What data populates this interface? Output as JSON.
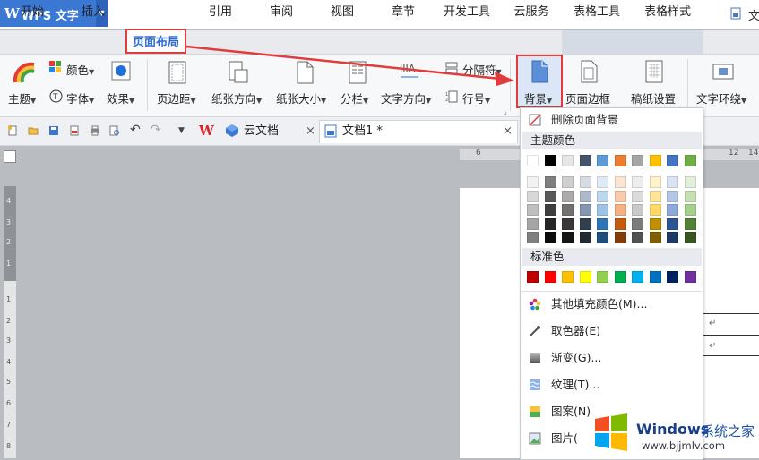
{
  "app": {
    "logo": "W",
    "name": "WPS 文字",
    "right_label": "文"
  },
  "tabs": [
    {
      "label": "开始"
    },
    {
      "label": "插入"
    },
    {
      "label": "页面布局"
    },
    {
      "label": "引用"
    },
    {
      "label": "审阅"
    },
    {
      "label": "视图"
    },
    {
      "label": "章节"
    },
    {
      "label": "开发工具"
    },
    {
      "label": "云服务"
    },
    {
      "label": "表格工具"
    },
    {
      "label": "表格样式"
    }
  ],
  "ribbon": {
    "theme": "主题",
    "color": "颜色",
    "font": "字体",
    "effect": "效果",
    "margins": "页边距",
    "orientation": "纸张方向",
    "size": "纸张大小",
    "columns": "分栏",
    "text_direction": "文字方向",
    "breaks": "分隔符",
    "line_numbers": "行号",
    "background": "背景",
    "page_border": "页面边框",
    "manuscript": "稿纸设置",
    "wrap": "文字环绕"
  },
  "doctabs": {
    "cloud": "云文档",
    "doc1": "文档1 *"
  },
  "menu": {
    "remove_bg": "删除页面背景",
    "theme_colors_header": "主题颜色",
    "standard_colors_header": "标准色",
    "more_fill": "其他填充颜色(M)...",
    "picker": "取色器(E)",
    "gradient": "渐变(G)...",
    "texture": "纹理(T)...",
    "pattern": "图案(N)",
    "picture": "图片("
  },
  "theme_top": [
    "#ffffff",
    "#000000",
    "#e7e6e6",
    "#44546a",
    "#5b9bd5",
    "#ed7d31",
    "#a5a5a5",
    "#ffc000",
    "#4472c4",
    "#70ad47"
  ],
  "theme_shades": [
    [
      "#f2f2f2",
      "#7f7f7f",
      "#d0cece",
      "#d6dce4",
      "#deebf6",
      "#fbe5d5",
      "#ededed",
      "#fff2cc",
      "#dae3f3",
      "#e2efd9"
    ],
    [
      "#d8d8d8",
      "#595959",
      "#aeabab",
      "#adb9ca",
      "#bdd7ee",
      "#f7cbac",
      "#dbdbdb",
      "#fee599",
      "#b4c6e7",
      "#c5e0b3"
    ],
    [
      "#bfbfbf",
      "#3f3f3f",
      "#757070",
      "#8496b0",
      "#9cc3e5",
      "#f4b183",
      "#c9c9c9",
      "#ffd965",
      "#8eaadb",
      "#a8d08d"
    ],
    [
      "#a5a5a5",
      "#262626",
      "#3a3838",
      "#323f4f",
      "#2e75b5",
      "#c55a11",
      "#7b7b7b",
      "#bf9000",
      "#2f5496",
      "#538135"
    ],
    [
      "#7f7f7f",
      "#0c0c0c",
      "#171616",
      "#222a35",
      "#1e4e79",
      "#833c0b",
      "#525252",
      "#7f6000",
      "#1f3864",
      "#375623"
    ]
  ],
  "standard_colors": [
    "#c00000",
    "#ff0000",
    "#ffc000",
    "#ffff00",
    "#92d050",
    "#00b050",
    "#00b0f0",
    "#0070c0",
    "#002060",
    "#7030a0"
  ],
  "watermark": {
    "brand": "Windows",
    "brand_cn": "系统之家",
    "url": "www.bjjmlv.com"
  },
  "ruler": {
    "top_left": "6",
    "top_right": "12",
    "top_right2": "14"
  },
  "vruler_numbers": [
    "4",
    "3",
    "2",
    "1",
    "1",
    "2",
    "3",
    "4",
    "5",
    "6",
    "7",
    "8"
  ],
  "para_marks": [
    "↵",
    "↵"
  ]
}
